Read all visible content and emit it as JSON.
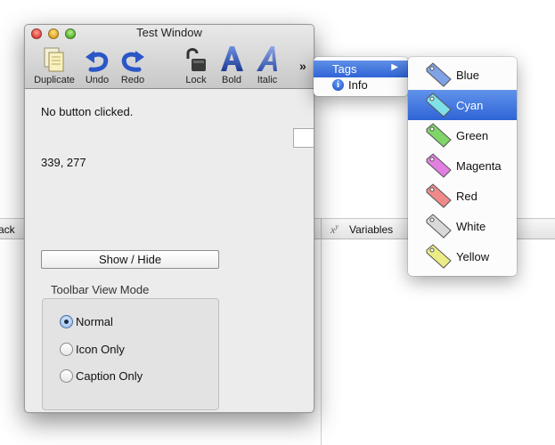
{
  "background": {
    "left_tab_partial": "ack",
    "xy_glyph": "x",
    "xy_sup": "y",
    "variables_label": "Variables"
  },
  "window": {
    "title": "Test Window",
    "toolbar": {
      "items": [
        {
          "label": "Duplicate",
          "icon": "duplicate-icon"
        },
        {
          "label": "Undo",
          "icon": "undo-icon"
        },
        {
          "label": "Redo",
          "icon": "redo-icon"
        },
        {
          "label": "Lock",
          "icon": "lock-icon"
        },
        {
          "label": "Bold",
          "icon": "bold-icon"
        },
        {
          "label": "Italic",
          "icon": "italic-icon"
        }
      ],
      "overflow": "»"
    },
    "status": "No button clicked.",
    "coords": "339, 277",
    "show_hide_label": "Show / Hide",
    "view_mode": {
      "title": "Toolbar View Mode",
      "options": [
        {
          "label": "Normal",
          "selected": true
        },
        {
          "label": "Icon Only",
          "selected": false
        },
        {
          "label": "Caption Only",
          "selected": false
        }
      ]
    }
  },
  "overflow_menu": {
    "items": [
      {
        "label": "Tags",
        "submenu_arrow": "▶",
        "highlighted": true
      },
      {
        "label": "Info",
        "icon": "info-icon",
        "icon_glyph": "i"
      }
    ]
  },
  "tags_menu": {
    "items": [
      {
        "label": "Blue",
        "color": "#7fa3e6",
        "selected": false
      },
      {
        "label": "Cyan",
        "color": "#7fe0e8",
        "selected": true
      },
      {
        "label": "Green",
        "color": "#7fd46a",
        "selected": false
      },
      {
        "label": "Magenta",
        "color": "#e27fe0",
        "selected": false
      },
      {
        "label": "Red",
        "color": "#ef8a8a",
        "selected": false
      },
      {
        "label": "White",
        "color": "#d9d9d9",
        "selected": false
      },
      {
        "label": "Yellow",
        "color": "#ecec86",
        "selected": false
      }
    ]
  },
  "colors": {
    "selection": "#3b6fdc",
    "window_bg": "#ececec"
  }
}
